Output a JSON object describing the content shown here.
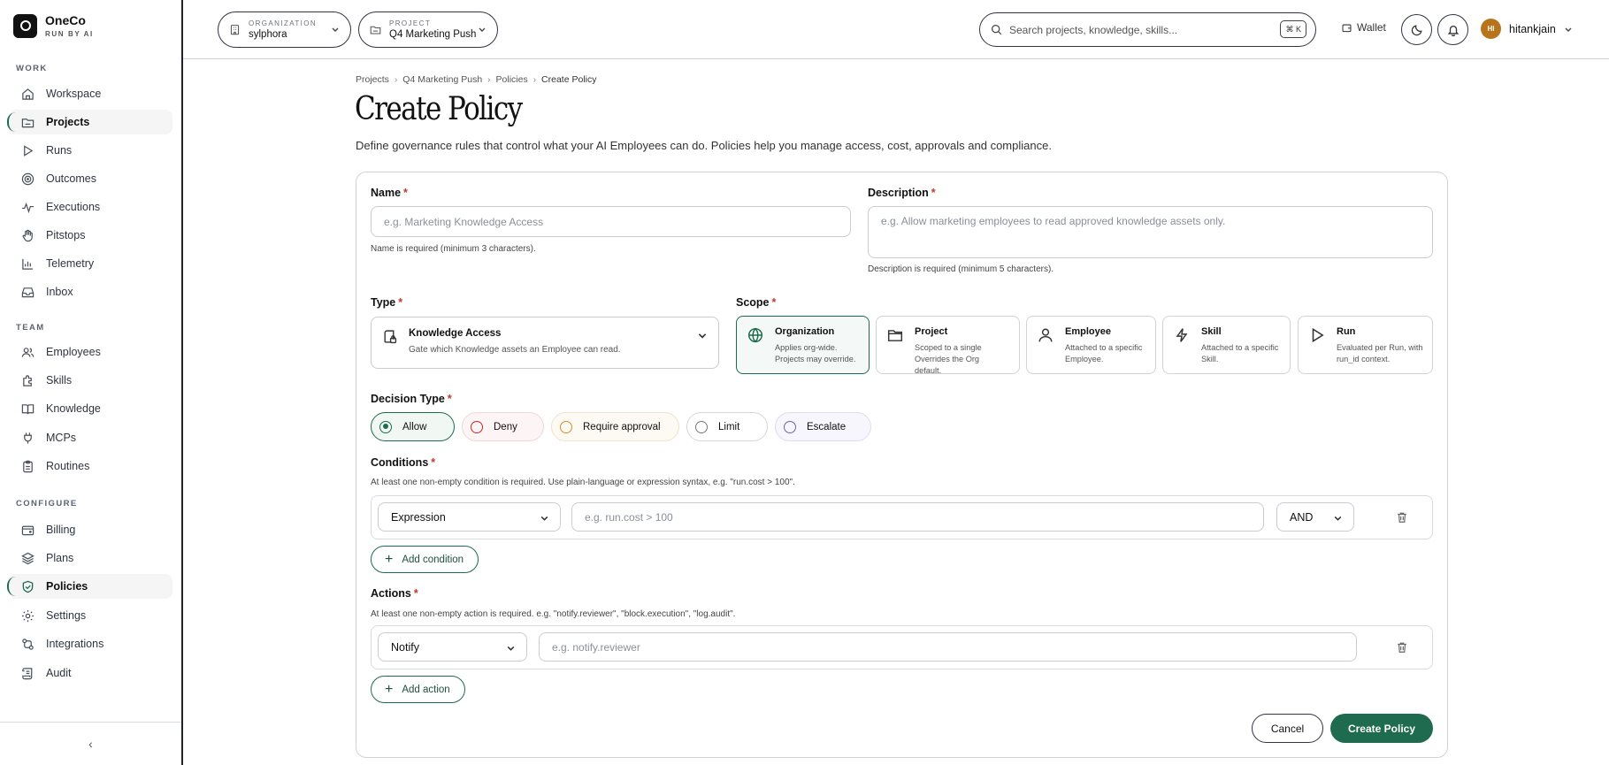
{
  "brand": {
    "name": "OneCo",
    "tagline": "RUN BY AI"
  },
  "sidebar": {
    "sections": [
      {
        "title": "WORK",
        "items": [
          {
            "label": "Workspace",
            "icon": "home-icon"
          },
          {
            "label": "Projects",
            "icon": "folder-icon",
            "active": true
          },
          {
            "label": "Runs",
            "icon": "play-icon"
          },
          {
            "label": "Outcomes",
            "icon": "target-icon"
          },
          {
            "label": "Executions",
            "icon": "activity-icon"
          },
          {
            "label": "Pitstops",
            "icon": "hand-icon"
          },
          {
            "label": "Telemetry",
            "icon": "chart-icon"
          },
          {
            "label": "Inbox",
            "icon": "inbox-icon"
          }
        ]
      },
      {
        "title": "TEAM",
        "items": [
          {
            "label": "Employees",
            "icon": "users-icon"
          },
          {
            "label": "Skills",
            "icon": "puzzle-icon"
          },
          {
            "label": "Knowledge",
            "icon": "book-icon"
          },
          {
            "label": "MCPs",
            "icon": "plug-icon"
          },
          {
            "label": "Routines",
            "icon": "clipboard-icon"
          }
        ]
      },
      {
        "title": "CONFIGURE",
        "items": [
          {
            "label": "Billing",
            "icon": "wallet-icon"
          },
          {
            "label": "Plans",
            "icon": "layers-icon"
          },
          {
            "label": "Policies",
            "icon": "shield-check-icon",
            "active": true
          },
          {
            "label": "Settings",
            "icon": "gear-icon"
          },
          {
            "label": "Integrations",
            "icon": "integrations-icon"
          },
          {
            "label": "Audit",
            "icon": "scroll-icon"
          }
        ]
      }
    ],
    "collapse_glyph": "‹"
  },
  "topbar": {
    "organization": {
      "label": "ORGANIZATION",
      "value": "sylphora"
    },
    "project": {
      "label": "PROJECT",
      "value": "Q4 Marketing Push"
    },
    "search": {
      "placeholder": "Search projects, knowledge, skills...",
      "shortcut": "⌘ K"
    },
    "wallet_label": "Wallet",
    "user": {
      "initials": "HI",
      "name": "hitankjain"
    }
  },
  "breadcrumb": [
    "Projects",
    "Q4 Marketing Push",
    "Policies",
    "Create Policy"
  ],
  "page": {
    "title": "Create Policy",
    "subtitle": "Define governance rules that control what your AI Employees can do. Policies help you manage access, cost, approvals and compliance."
  },
  "form": {
    "name": {
      "label": "Name",
      "placeholder": "e.g. Marketing Knowledge Access",
      "hint": "Name is required (minimum 3 characters)."
    },
    "description": {
      "label": "Description",
      "placeholder": "e.g. Allow marketing employees to read approved knowledge assets only.",
      "hint": "Description is required (minimum 5 characters)."
    },
    "type": {
      "label": "Type",
      "title": "Knowledge Access",
      "desc": "Gate which Knowledge assets an Employee can read."
    },
    "scope": {
      "label": "Scope",
      "options": [
        {
          "title": "Organization",
          "desc": "Applies org-wide. Projects may override.",
          "icon": "globe-icon",
          "selected": true
        },
        {
          "title": "Project",
          "desc": "Scoped to a single Overrides the Org default.",
          "icon": "folder-icon"
        },
        {
          "title": "Employee",
          "desc": "Attached to a specific Employee.",
          "icon": "user-icon"
        },
        {
          "title": "Skill",
          "desc": "Attached to a specific Skill.",
          "icon": "bolt-icon"
        },
        {
          "title": "Run",
          "desc": "Evaluated per Run, with run_id context.",
          "icon": "play-icon"
        }
      ]
    },
    "decision": {
      "label": "Decision Type",
      "options": [
        "Allow",
        "Deny",
        "Require approval",
        "Limit",
        "Escalate"
      ],
      "selected": "Allow"
    },
    "conditions": {
      "label": "Conditions",
      "hint": "At least one non-empty condition is required. Use plain-language or expression syntax, e.g. \"run.cost > 100\".",
      "mode": "Expression",
      "placeholder": "e.g. run.cost > 100",
      "joiner": "AND",
      "add_label": "Add condition"
    },
    "actions": {
      "label": "Actions",
      "hint": "At least one non-empty action is required. e.g. \"notify.reviewer\", \"block.execution\", \"log.audit\".",
      "action": "Notify",
      "placeholder": "e.g. notify.reviewer",
      "add_label": "Add action"
    },
    "cancel_label": "Cancel",
    "submit_label": "Create Policy"
  },
  "colors": {
    "accent": "#1e6b4f",
    "required": "#c0392b",
    "avatar": "#b8741a"
  }
}
